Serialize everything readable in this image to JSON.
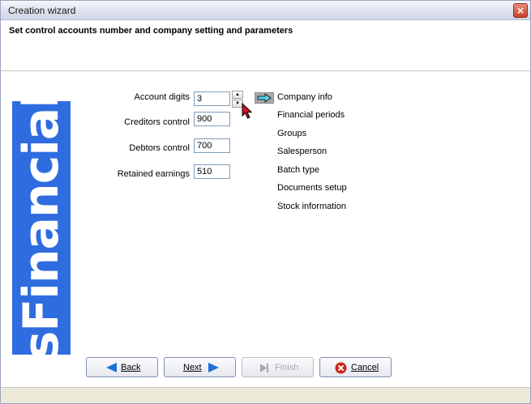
{
  "window": {
    "title": "Creation wizard",
    "close_symbol": "×"
  },
  "header": {
    "text": "Set control accounts number and company setting and parameters"
  },
  "logo": {
    "text": "osFinancials",
    "color": "#2f6ce0"
  },
  "form": {
    "account_digits": {
      "label": "Account digits",
      "value": "3"
    },
    "creditors_control": {
      "label": "Creditors control",
      "value": "900"
    },
    "debtors_control": {
      "label": "Debtors control",
      "value": "700"
    },
    "retained_earnings": {
      "label": "Retained earnings",
      "value": "510"
    }
  },
  "steps": [
    {
      "label": "Company info",
      "current": true
    },
    {
      "label": "Financial periods"
    },
    {
      "label": "Groups"
    },
    {
      "label": "Salesperson"
    },
    {
      "label": "Batch type"
    },
    {
      "label": "Documents setup"
    },
    {
      "label": "Stock information"
    }
  ],
  "buttons": {
    "back": "Back",
    "next": "Next",
    "finish": "Finish",
    "cancel": "Cancel"
  },
  "colors": {
    "arrow": "#4fd6f0",
    "nav_arrow": "#1f6fd6",
    "cancel_icon": "#c8281a"
  }
}
